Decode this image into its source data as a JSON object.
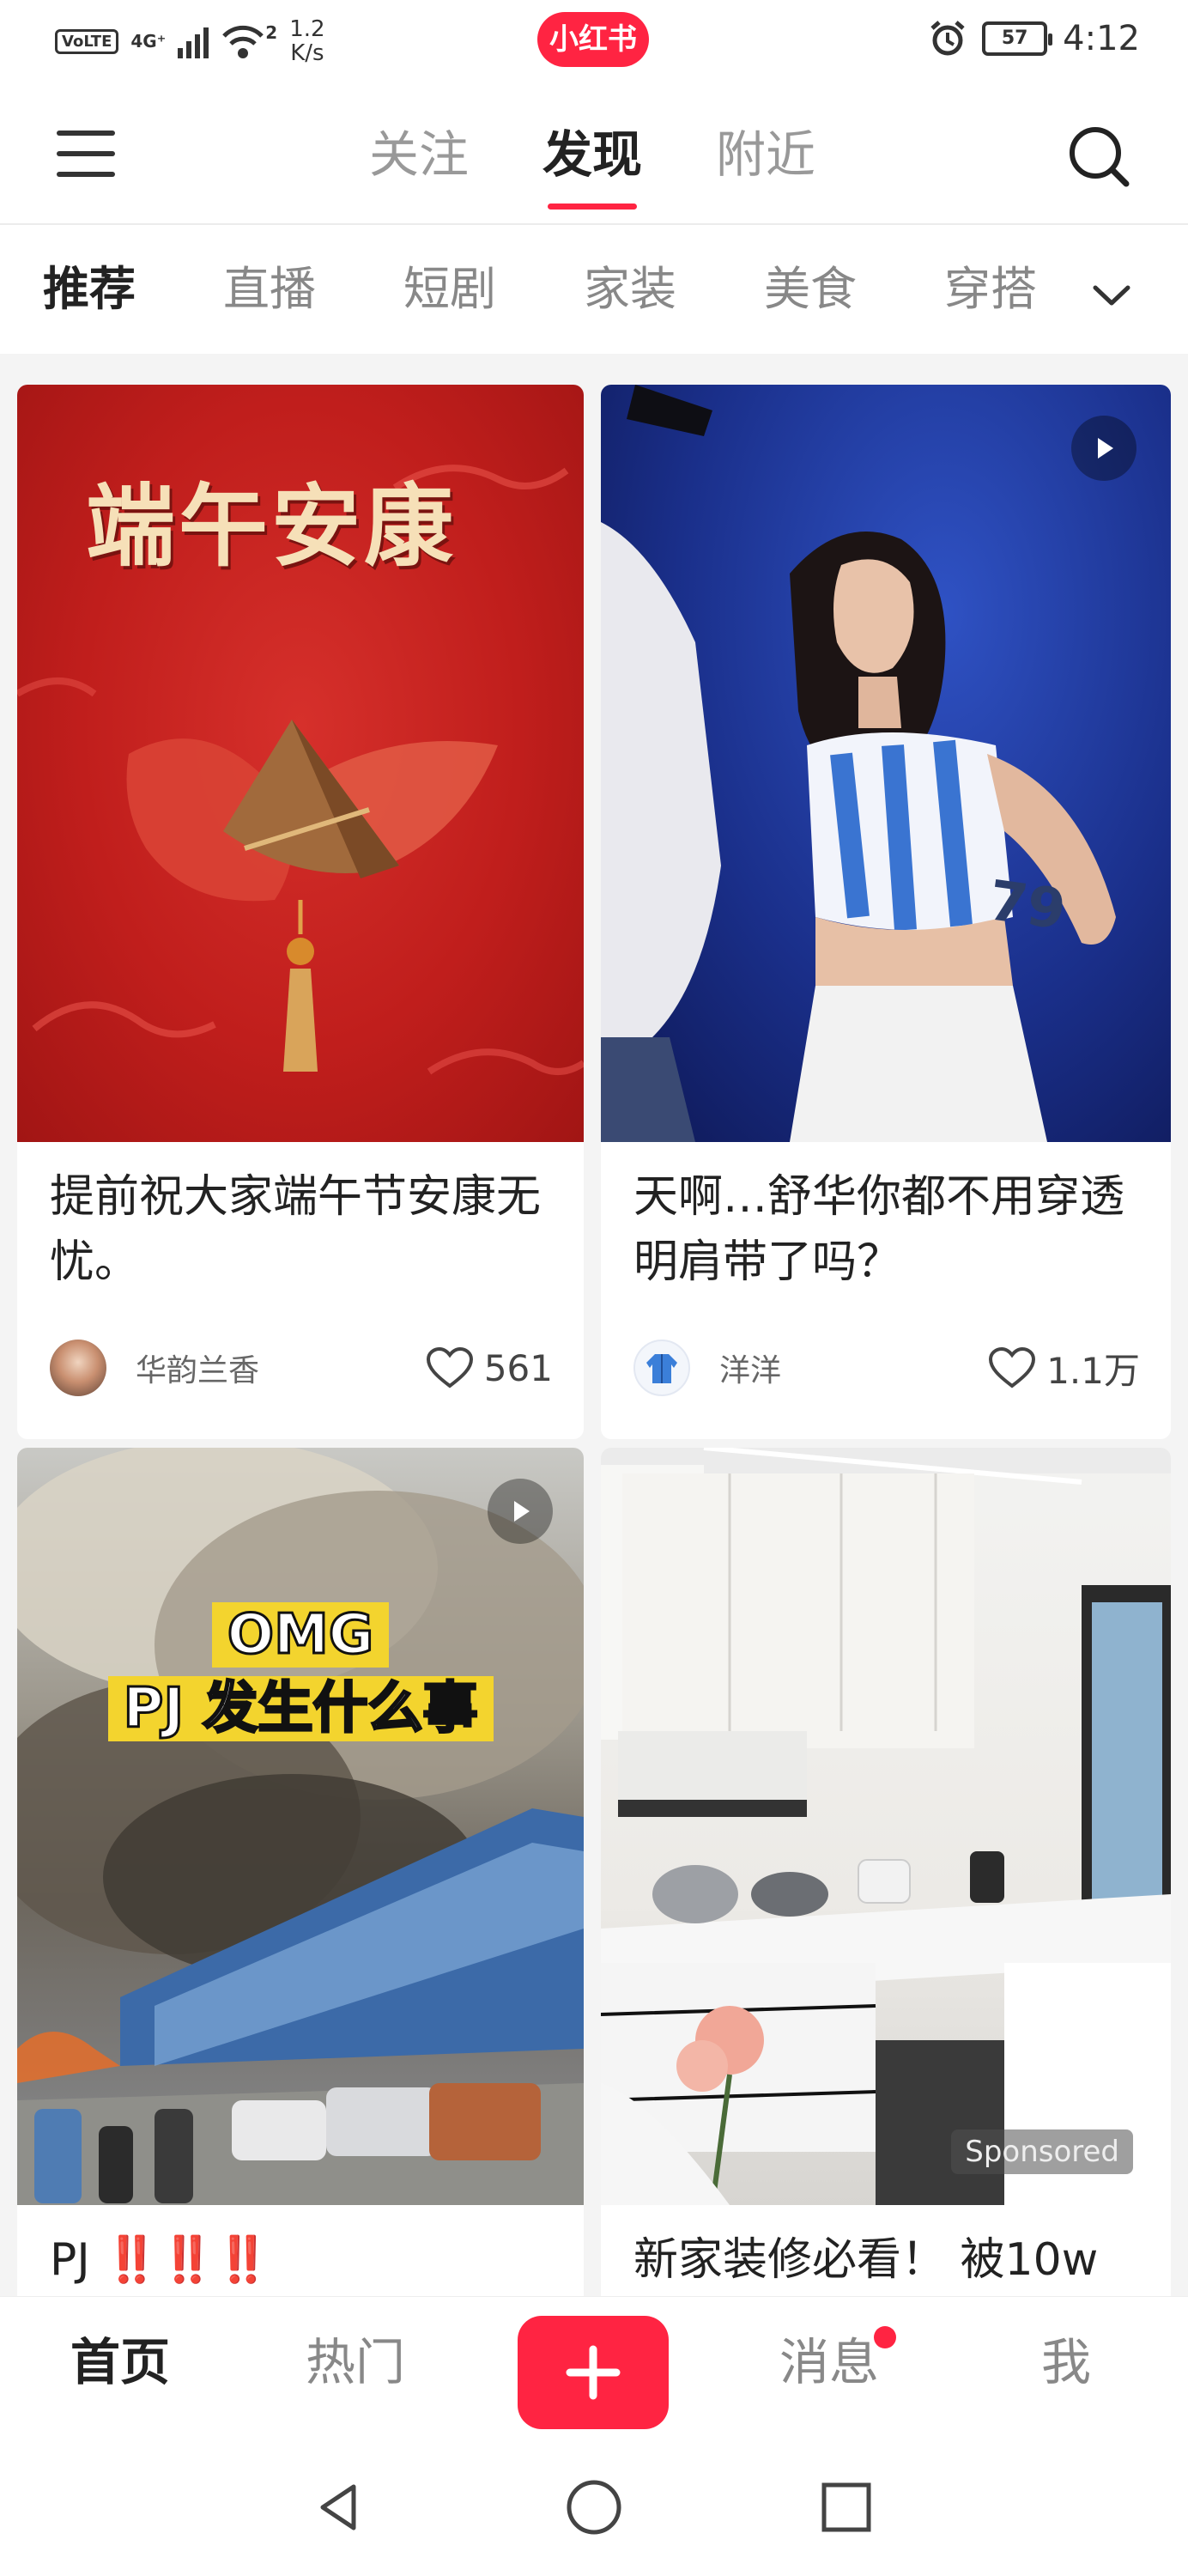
{
  "status_bar": {
    "carrier_chip": "VoLTE",
    "network": "4G⁺",
    "wifi_level": "2",
    "speed_value": "1.2",
    "speed_unit": "K/s",
    "app_badge": "小红书",
    "battery": "57",
    "time": "4:12"
  },
  "top_nav": {
    "tabs": [
      {
        "label": "关注",
        "active": false
      },
      {
        "label": "发现",
        "active": true
      },
      {
        "label": "附近",
        "active": false
      }
    ]
  },
  "channels": {
    "items": [
      "推荐",
      "直播",
      "短剧",
      "家装",
      "美食",
      "穿搭"
    ],
    "active_index": 0
  },
  "feed": {
    "cards": [
      {
        "image_text": "端午安康",
        "title": "提前祝大家端午节安康无忧。",
        "author": "华韵兰香",
        "likes": "561",
        "is_video": false
      },
      {
        "image_text": "79",
        "title": "天啊…舒华你都不用穿透明肩带了吗？",
        "author": "洋洋",
        "likes": "1.1万",
        "is_video": true
      },
      {
        "image_text_line1": "OMG",
        "image_text_line2": "PJ 发生什么事",
        "title_prefix": "PJ",
        "title_marks": "‼️‼️‼️",
        "is_video": true
      },
      {
        "title": "新家装修必看！ 被10w",
        "sponsored_label": "Sponsored",
        "is_video": false
      }
    ]
  },
  "bottom_bar": {
    "home": "首页",
    "hot": "热门",
    "messages": "消息",
    "me": "我"
  },
  "colors": {
    "brand_red": "#ff2442",
    "text_primary": "#222222",
    "text_secondary": "#888888",
    "feed_background": "#f4f4f4"
  },
  "icons": [
    "menu-icon",
    "search-icon",
    "chevron-down-icon",
    "heart-icon",
    "play-icon",
    "plus-icon",
    "back-triangle-icon",
    "home-circle-icon",
    "recents-square-icon",
    "alarm-icon"
  ]
}
